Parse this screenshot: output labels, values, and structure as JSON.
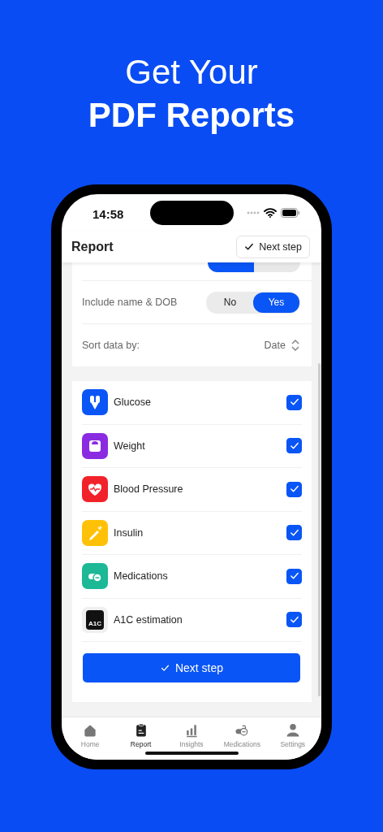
{
  "headline": {
    "line_1": "Get Your",
    "line_2": "PDF Reports"
  },
  "status_bar": {
    "time": "14:58"
  },
  "header": {
    "title": "Report",
    "button": "Next step"
  },
  "settings": [
    {
      "kind": "toggle",
      "label": "Include name & DOB",
      "options": [
        {
          "label": "No",
          "selected": false
        },
        {
          "label": "Yes",
          "selected": true
        }
      ]
    },
    {
      "kind": "select",
      "label": "Sort data by:",
      "value": "Date"
    }
  ],
  "data_types": [
    {
      "label": "Glucose",
      "color": "#0a55f5",
      "checked": true
    },
    {
      "label": "Weight",
      "color": "#8a2be2",
      "checked": true
    },
    {
      "label": "Blood Pressure",
      "color": "#f2222a",
      "checked": true
    },
    {
      "label": "Insulin",
      "color": "#ffc107",
      "checked": true
    },
    {
      "label": "Medications",
      "color": "#1db896",
      "checked": true
    },
    {
      "label": "A1C estimation",
      "color": "#efefef",
      "icon_text": "A1C",
      "checked": true
    }
  ],
  "primary_button": "Next step",
  "tab_bar": [
    {
      "label": "Home",
      "selected": false
    },
    {
      "label": "Report",
      "selected": true
    },
    {
      "label": "Insights",
      "selected": false
    },
    {
      "label": "Medications",
      "selected": false
    },
    {
      "label": "Settings",
      "selected": false
    }
  ]
}
